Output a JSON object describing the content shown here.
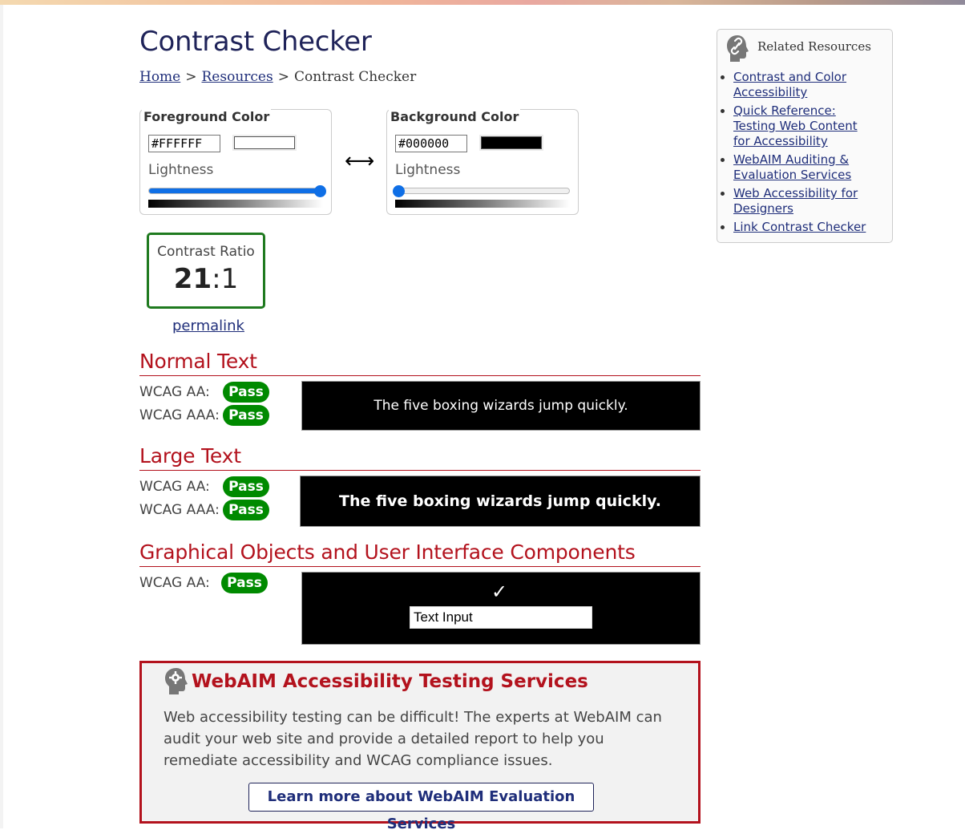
{
  "page": {
    "title": "Contrast Checker",
    "breadcrumb": {
      "home": "Home",
      "sep1": ">",
      "resources": "Resources",
      "sep2": ">",
      "current": "Contrast Checker"
    }
  },
  "colors": {
    "heading": "#1f2359",
    "section": "#b3121d",
    "pass": "#008a00",
    "link": "#1f2e7a",
    "accent": "#0f6fe6"
  },
  "foreground": {
    "legend": "Foreground Color",
    "hex": "#FFFFFF",
    "swatch_color": "#FFFFFF",
    "lightness_label": "Lightness",
    "lightness_percent": 100
  },
  "background": {
    "legend": "Background Color",
    "hex": "#000000",
    "swatch_color": "#000000",
    "lightness_label": "Lightness",
    "lightness_percent": 0
  },
  "swap": {
    "glyph": "⟷",
    "icon": "swap-arrows-icon"
  },
  "contrast": {
    "label": "Contrast Ratio",
    "ratio_main": "21",
    "ratio_sep": ":",
    "ratio_rest": "1",
    "permalink": "permalink"
  },
  "normal_text": {
    "heading": "Normal Text",
    "aa_label": "WCAG AA:",
    "aa_result": "Pass",
    "aaa_label": "WCAG AAA:",
    "aaa_result": "Pass",
    "sample": "The five boxing wizards jump quickly."
  },
  "large_text": {
    "heading": "Large Text",
    "aa_label": "WCAG AA:",
    "aa_result": "Pass",
    "aaa_label": "WCAG AAA:",
    "aaa_result": "Pass",
    "sample": "The five boxing wizards jump quickly."
  },
  "graphical": {
    "heading": "Graphical Objects and User Interface Components",
    "aa_label": "WCAG AA:",
    "aa_result": "Pass",
    "check": "✓",
    "input_value": "Text Input"
  },
  "promo": {
    "title": "WebAIM Accessibility Testing Services",
    "text": "Web accessibility testing can be difficult! The experts at WebAIM can audit your web site and provide a detailed report to help you remediate accessibility and WCAG compliance issues.",
    "button": "Learn more about WebAIM Evaluation Services",
    "icon": "gear-head-icon"
  },
  "related": {
    "title": "Related Resources",
    "icon": "link-head-icon",
    "items": [
      {
        "label": "Contrast and Color Accessibility"
      },
      {
        "label": "Quick Reference: Testing Web Content for Accessibility"
      },
      {
        "label": "WebAIM Auditing & Evaluation Services"
      },
      {
        "label": "Web Accessibility for Designers"
      },
      {
        "label": "Link Contrast Checker"
      }
    ]
  }
}
